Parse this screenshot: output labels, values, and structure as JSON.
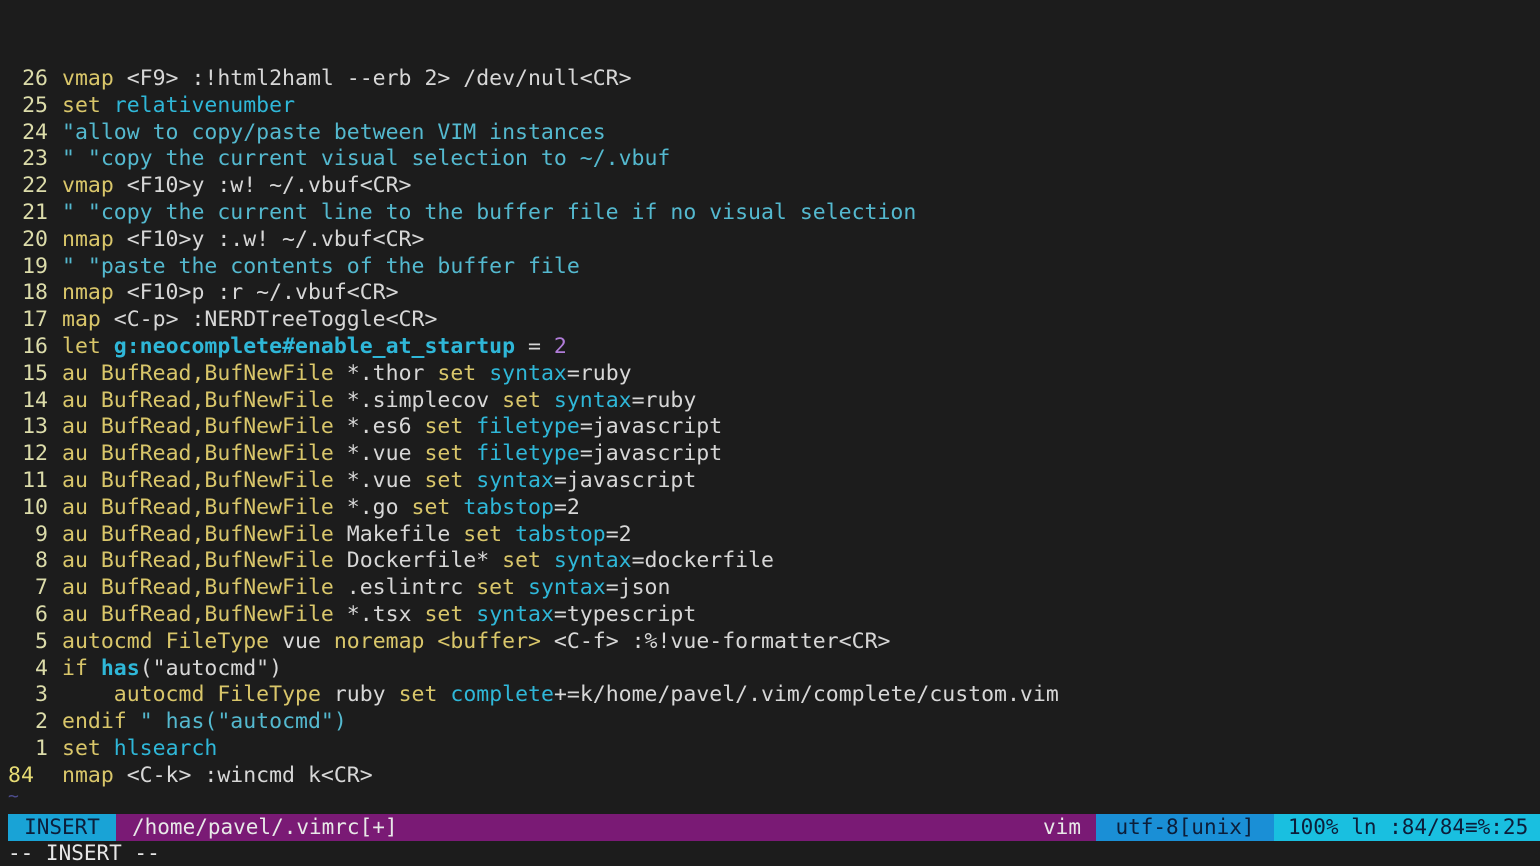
{
  "colors": {
    "background": "#1c1c1c",
    "line_number": "#dcdcaa",
    "keyword": "#d9c66a",
    "highlight": "#2fb7d8",
    "comment": "#54b9cf",
    "number": "#b07cd8",
    "statusline_mode_bg": "#19a3d6",
    "statusline_file_bg": "#7a1a75",
    "statusline_enc_bg": "#1a8fd6",
    "statusline_pos_bg": "#19bfe0"
  },
  "editor": {
    "lines": [
      {
        "num": "26",
        "tokens": [
          [
            "kw",
            "vmap"
          ],
          [
            "tx",
            " <F9> :!html2haml --erb 2> /dev/null<CR>"
          ]
        ]
      },
      {
        "num": "25",
        "tokens": [
          [
            "kw",
            "set"
          ],
          [
            "tx",
            " "
          ],
          [
            "hl",
            "relativenumber"
          ]
        ]
      },
      {
        "num": "24",
        "tokens": [
          [
            "cm",
            "\"allow to copy/paste between VIM instances"
          ]
        ]
      },
      {
        "num": "23",
        "tokens": [
          [
            "cm",
            "\" \"copy the current visual selection to ~/.vbuf"
          ]
        ]
      },
      {
        "num": "22",
        "tokens": [
          [
            "kw",
            "vmap"
          ],
          [
            "tx",
            " <F10>y :w! ~/.vbuf<CR>"
          ]
        ]
      },
      {
        "num": "21",
        "tokens": [
          [
            "cm",
            "\" \"copy the current line to the buffer file if no visual selection"
          ]
        ]
      },
      {
        "num": "20",
        "tokens": [
          [
            "kw",
            "nmap"
          ],
          [
            "tx",
            " <F10>y :.w! ~/.vbuf<CR>"
          ]
        ]
      },
      {
        "num": "19",
        "tokens": [
          [
            "cm",
            "\" \"paste the contents of the buffer file"
          ]
        ]
      },
      {
        "num": "18",
        "tokens": [
          [
            "kw",
            "nmap"
          ],
          [
            "tx",
            " <F10>p :r ~/.vbuf<CR>"
          ]
        ]
      },
      {
        "num": "17",
        "tokens": [
          [
            "kw",
            "map"
          ],
          [
            "tx",
            " <C-p> :NERDTreeToggle<CR>"
          ]
        ]
      },
      {
        "num": "16",
        "tokens": [
          [
            "kw",
            "let"
          ],
          [
            "tx",
            " "
          ],
          [
            "var",
            "g:neocomplete#enable_at_startup"
          ],
          [
            "tx",
            " = "
          ],
          [
            "num",
            "2"
          ]
        ]
      },
      {
        "num": "15",
        "tokens": [
          [
            "kw",
            "au"
          ],
          [
            "tx",
            " "
          ],
          [
            "id",
            "BufRead,BufNewFile"
          ],
          [
            "tx",
            " *.thor "
          ],
          [
            "kw",
            "set"
          ],
          [
            "tx",
            " "
          ],
          [
            "hl",
            "syntax"
          ],
          [
            "tx",
            "=ruby"
          ]
        ]
      },
      {
        "num": "14",
        "tokens": [
          [
            "kw",
            "au"
          ],
          [
            "tx",
            " "
          ],
          [
            "id",
            "BufRead,BufNewFile"
          ],
          [
            "tx",
            " *.simplecov "
          ],
          [
            "kw",
            "set"
          ],
          [
            "tx",
            " "
          ],
          [
            "hl",
            "syntax"
          ],
          [
            "tx",
            "=ruby"
          ]
        ]
      },
      {
        "num": "13",
        "tokens": [
          [
            "kw",
            "au"
          ],
          [
            "tx",
            " "
          ],
          [
            "id",
            "BufRead,BufNewFile"
          ],
          [
            "tx",
            " *.es6 "
          ],
          [
            "kw",
            "set"
          ],
          [
            "tx",
            " "
          ],
          [
            "hl",
            "filetype"
          ],
          [
            "tx",
            "=javascript"
          ]
        ]
      },
      {
        "num": "12",
        "tokens": [
          [
            "kw",
            "au"
          ],
          [
            "tx",
            " "
          ],
          [
            "id",
            "BufRead,BufNewFile"
          ],
          [
            "tx",
            " *.vue "
          ],
          [
            "kw",
            "set"
          ],
          [
            "tx",
            " "
          ],
          [
            "hl",
            "filetype"
          ],
          [
            "tx",
            "=javascript"
          ]
        ]
      },
      {
        "num": "11",
        "tokens": [
          [
            "kw",
            "au"
          ],
          [
            "tx",
            " "
          ],
          [
            "id",
            "BufRead,BufNewFile"
          ],
          [
            "tx",
            " *.vue "
          ],
          [
            "kw",
            "set"
          ],
          [
            "tx",
            " "
          ],
          [
            "hl",
            "syntax"
          ],
          [
            "tx",
            "=javascript"
          ]
        ]
      },
      {
        "num": "10",
        "tokens": [
          [
            "kw",
            "au"
          ],
          [
            "tx",
            " "
          ],
          [
            "id",
            "BufRead,BufNewFile"
          ],
          [
            "tx",
            " *.go "
          ],
          [
            "kw",
            "set"
          ],
          [
            "tx",
            " "
          ],
          [
            "hl",
            "tabstop"
          ],
          [
            "tx",
            "=2"
          ]
        ]
      },
      {
        "num": "9",
        "tokens": [
          [
            "kw",
            "au"
          ],
          [
            "tx",
            " "
          ],
          [
            "id",
            "BufRead,BufNewFile"
          ],
          [
            "tx",
            " Makefile "
          ],
          [
            "kw",
            "set"
          ],
          [
            "tx",
            " "
          ],
          [
            "hl",
            "tabstop"
          ],
          [
            "tx",
            "=2"
          ]
        ]
      },
      {
        "num": "8",
        "tokens": [
          [
            "kw",
            "au"
          ],
          [
            "tx",
            " "
          ],
          [
            "id",
            "BufRead,BufNewFile"
          ],
          [
            "tx",
            " Dockerfile* "
          ],
          [
            "kw",
            "set"
          ],
          [
            "tx",
            " "
          ],
          [
            "hl",
            "syntax"
          ],
          [
            "tx",
            "=dockerfile"
          ]
        ]
      },
      {
        "num": "7",
        "tokens": [
          [
            "kw",
            "au"
          ],
          [
            "tx",
            " "
          ],
          [
            "id",
            "BufRead,BufNewFile"
          ],
          [
            "tx",
            " .eslintrc "
          ],
          [
            "kw",
            "set"
          ],
          [
            "tx",
            " "
          ],
          [
            "hl",
            "syntax"
          ],
          [
            "tx",
            "=json"
          ]
        ]
      },
      {
        "num": "6",
        "tokens": [
          [
            "kw",
            "au"
          ],
          [
            "tx",
            " "
          ],
          [
            "id",
            "BufRead,BufNewFile"
          ],
          [
            "tx",
            " *.tsx "
          ],
          [
            "kw",
            "set"
          ],
          [
            "tx",
            " "
          ],
          [
            "hl",
            "syntax"
          ],
          [
            "tx",
            "=typescript"
          ]
        ]
      },
      {
        "num": "5",
        "tokens": [
          [
            "kw",
            "autocmd"
          ],
          [
            "tx",
            " "
          ],
          [
            "id",
            "FileType"
          ],
          [
            "tx",
            " vue "
          ],
          [
            "kw",
            "noremap"
          ],
          [
            "tx",
            " "
          ],
          [
            "id",
            "<buffer>"
          ],
          [
            "tx",
            " <C-f> :%!vue-formatter<CR>"
          ]
        ]
      },
      {
        "num": "4",
        "tokens": [
          [
            "kw",
            "if"
          ],
          [
            "tx",
            " "
          ],
          [
            "var",
            "has"
          ],
          [
            "tx",
            "(\"autocmd\")"
          ]
        ]
      },
      {
        "num": "3",
        "tokens": [
          [
            "tx",
            "    "
          ],
          [
            "kw",
            "autocmd"
          ],
          [
            "tx",
            " "
          ],
          [
            "id",
            "FileType"
          ],
          [
            "tx",
            " ruby "
          ],
          [
            "kw",
            "set"
          ],
          [
            "tx",
            " "
          ],
          [
            "hl",
            "complete"
          ],
          [
            "tx",
            "+=k/home/pavel/.vim/complete/custom.vim"
          ]
        ]
      },
      {
        "num": "2",
        "tokens": [
          [
            "kw",
            "endif"
          ],
          [
            "tx",
            " "
          ],
          [
            "cm",
            "\" has(\"autocmd\")"
          ]
        ]
      },
      {
        "num": "1",
        "tokens": [
          [
            "kw",
            "set"
          ],
          [
            "tx",
            " "
          ],
          [
            "hl",
            "hlsearch"
          ]
        ]
      },
      {
        "num": "84",
        "current": true,
        "tokens": [
          [
            "kw",
            "nmap"
          ],
          [
            "tx",
            " <C-k> :wincmd k<CR>"
          ]
        ]
      }
    ],
    "tilde": "~"
  },
  "statusline": {
    "mode": "INSERT",
    "file": "/home/pavel/.vimrc[+]",
    "filetype": "vim",
    "encoding": "utf-8[unix]",
    "position": "100% ln :84/84≡%:25"
  },
  "cmdline": {
    "text": "-- INSERT --"
  }
}
